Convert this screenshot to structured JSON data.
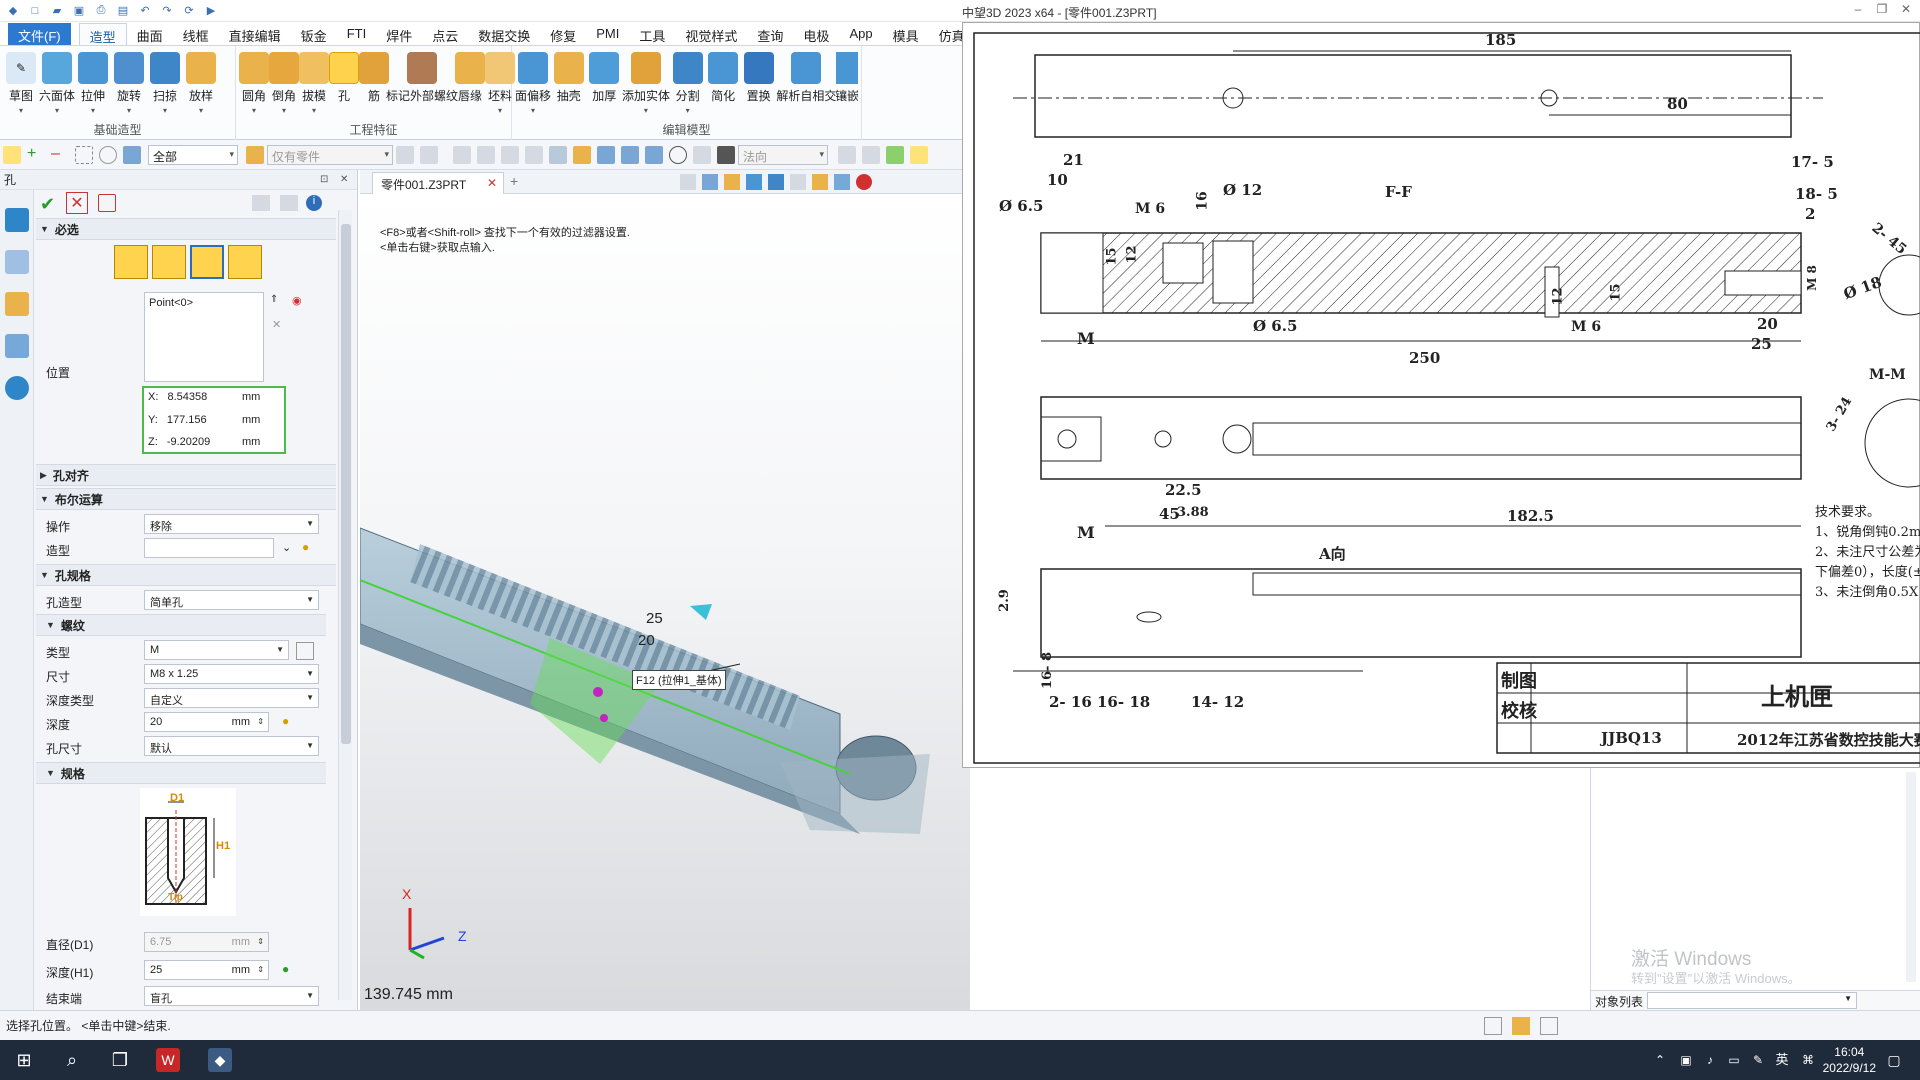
{
  "title_bar": {
    "title": "中望3D 2023 x64 - [零件001.Z3PRT]"
  },
  "menu": {
    "items": [
      "文件(F)",
      "造型",
      "曲面",
      "线框",
      "直接编辑",
      "钣金",
      "FTI",
      "焊件",
      "点云",
      "数据交换",
      "修复",
      "PMI",
      "工具",
      "视觉样式",
      "查询",
      "电极",
      "App",
      "模具",
      "仿真"
    ]
  },
  "ribbon": {
    "groups": [
      {
        "label": "基础造型",
        "buttons": [
          "草图",
          "六面体",
          "拉伸",
          "旋转",
          "扫掠",
          "放样"
        ]
      },
      {
        "label": "工程特征",
        "buttons": [
          "圆角",
          "倒角",
          "拔模",
          "孔",
          "筋",
          "标记外部螺纹",
          "唇缘",
          "坯料"
        ]
      },
      {
        "label": "编辑模型",
        "buttons": [
          "面偏移",
          "抽壳",
          "加厚",
          "添加实体",
          "分割",
          "简化",
          "置换",
          "解析自相交",
          "镶嵌"
        ]
      }
    ]
  },
  "filter_bar": {
    "filter": "全部",
    "part_filter": "仅有零件",
    "direction": "法向"
  },
  "panel": {
    "title": "孔",
    "sections": {
      "required": "必选",
      "position_label": "位置",
      "point_item": "Point<0>",
      "coords": {
        "x_label": "X:",
        "x": "8.54358",
        "y_label": "Y:",
        "y": "177.156",
        "z_label": "Z:",
        "z": "-9.20209",
        "unit": "mm"
      },
      "hole_align": "孔对齐",
      "boolean": "布尔运算",
      "operation_label": "操作",
      "operation_value": "移除",
      "shape_label": "造型",
      "hole_spec": "孔规格",
      "hole_type_label": "孔造型",
      "hole_type_value": "简单孔",
      "thread": "螺纹",
      "type_label": "类型",
      "type_value": "M",
      "size_label": "尺寸",
      "size_value": "M8 x 1.25",
      "depth_type_label": "深度类型",
      "depth_type_value": "自定义",
      "depth_label": "深度",
      "depth_value": "20",
      "hole_size_label": "孔尺寸",
      "hole_size_value": "默认",
      "spec": "规格",
      "diameter_label": "直径(D1)",
      "diameter_value": "6.75",
      "depth_h1_label": "深度(H1)",
      "depth_h1_value": "25",
      "end_label": "结束端",
      "end_value": "盲孔",
      "diagram_labels": {
        "d1": "D1",
        "h1": "H1",
        "tip": "Tip"
      }
    }
  },
  "doc_tab": {
    "label": "零件001.Z3PRT"
  },
  "viewport": {
    "hint_line1": "<F8>或者<Shift-roll> 查找下一个有效的过滤器设置.",
    "hint_line2": "<单击右键>获取点输入.",
    "tooltip": "F12 (拉伸1_基体)",
    "dim_25": "25",
    "dim_20": "20",
    "scale_readout": "139.745 mm",
    "axis_x": "X",
    "axis_z": "Z"
  },
  "drawing": {
    "dims": [
      "185",
      "80",
      "21",
      "10",
      "Ø 6.5",
      "M 6",
      "16",
      "Ø 12",
      "15",
      "12",
      "F-F",
      "17- 5",
      "18- 5",
      "2",
      "2- 45",
      "Ø 18",
      "M 8",
      "M",
      "Ø 6.5",
      "M 6",
      "12",
      "15",
      "20",
      "25",
      "250",
      "22.5",
      "45",
      "3.88",
      "182.5",
      "A向",
      "2.9",
      "16- 8",
      "2- 16",
      "16- 18",
      "14- 12",
      "M",
      "M-M",
      "3- 24"
    ],
    "notes": [
      "技术要求。",
      "1、锐角倒钝0.2m",
      "2、未注尺寸公差为",
      "下偏差0），长度(±",
      "3、未注倒角0.5X"
    ],
    "title_block": {
      "drawn": "制图",
      "checked": "校核",
      "code": "JJBQ13",
      "name": "上机匣",
      "contest": "2012年江苏省数控技能大赛"
    }
  },
  "object_panel": {
    "watermark_line1": "激活 Windows",
    "watermark_line2": "转到\"设置\"以激活 Windows。",
    "list_label": "对象列表"
  },
  "status": {
    "text": "选择孔位置。 <单击中键>结束."
  },
  "taskbar": {
    "time": "16:04",
    "date": "2022/9/12",
    "ime": "英"
  }
}
